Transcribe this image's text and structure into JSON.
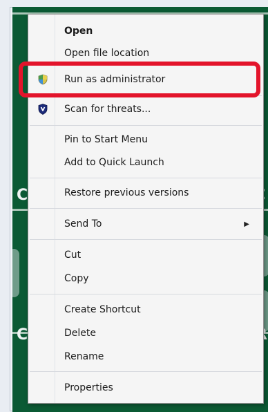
{
  "menu": {
    "items": [
      {
        "label": "Open",
        "bold": true,
        "icon": ""
      },
      {
        "label": "Open file location",
        "icon": ""
      },
      {
        "label": "Run as administrator",
        "icon": "uac-shield-icon"
      },
      {
        "label": "Scan for threats...",
        "icon": "antivirus-shield-icon"
      },
      {
        "label": "Pin to Start Menu",
        "icon": ""
      },
      {
        "label": "Add to Quick Launch",
        "icon": ""
      },
      {
        "label": "Restore previous versions",
        "icon": ""
      },
      {
        "label": "Send To",
        "icon": "",
        "submenu": true
      },
      {
        "label": "Cut",
        "icon": ""
      },
      {
        "label": "Copy",
        "icon": ""
      },
      {
        "label": "Create Shortcut",
        "icon": ""
      },
      {
        "label": "Delete",
        "icon": ""
      },
      {
        "label": "Rename",
        "icon": ""
      },
      {
        "label": "Properties",
        "icon": ""
      }
    ],
    "highlighted_item": "Run as administrator",
    "highlight_color": "#e3142b"
  }
}
